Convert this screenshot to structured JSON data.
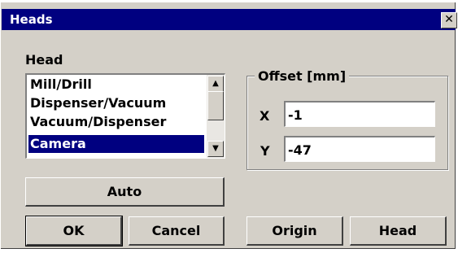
{
  "window": {
    "title": "Heads",
    "close_glyph": "✕"
  },
  "head": {
    "label": "Head",
    "items": [
      "Mill/Drill",
      "Dispenser/Vacuum",
      "Vacuum/Dispenser",
      "Camera"
    ],
    "selected": "Camera"
  },
  "scrollbar": {
    "up_glyph": "▲",
    "down_glyph": "▼"
  },
  "offset": {
    "label": "Offset [mm]",
    "x_label": "X",
    "x_value": "-1",
    "y_label": "Y",
    "y_value": "-47"
  },
  "buttons": {
    "auto": "Auto",
    "ok": "OK",
    "cancel": "Cancel",
    "origin": "Origin",
    "head": "Head"
  },
  "colors": {
    "titlebar": "#000080",
    "face": "#d4d0c8",
    "selection": "#000080"
  }
}
